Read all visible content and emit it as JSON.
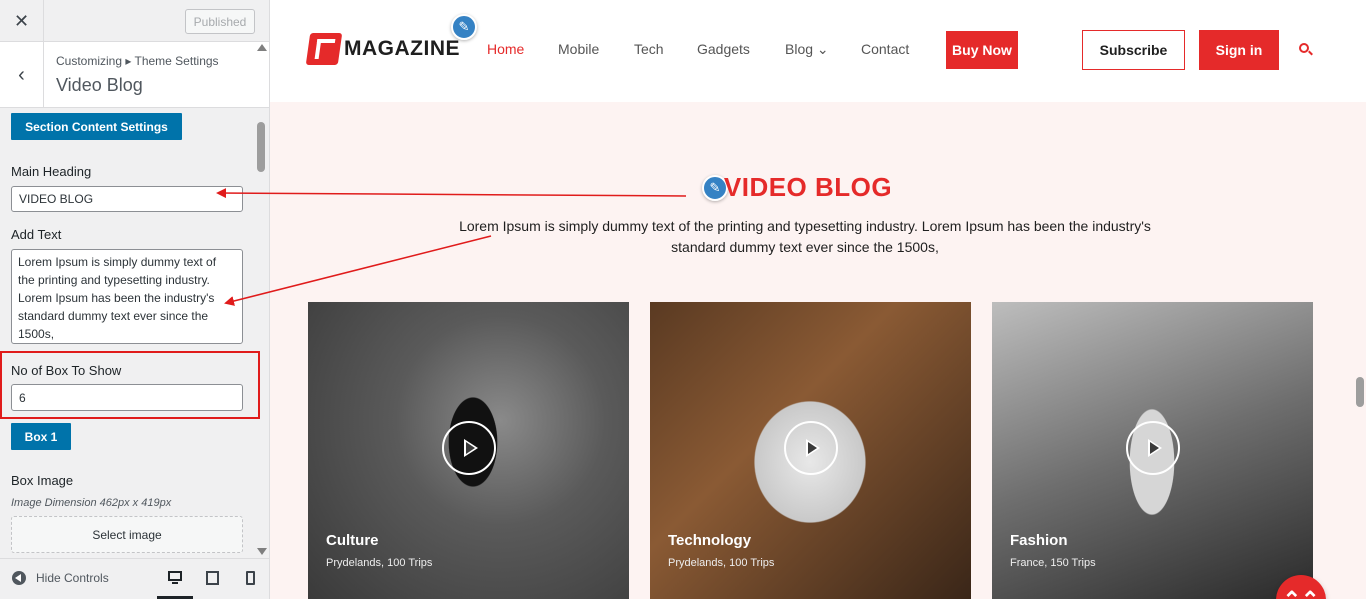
{
  "customizer": {
    "close_label": "✕",
    "published_label": "Published",
    "back_label": "‹",
    "breadcrumb": "Customizing ▸ Theme Settings",
    "title": "Video Blog",
    "section_button": "Section Content Settings",
    "main_heading_label": "Main Heading",
    "main_heading_value": "VIDEO BLOG",
    "add_text_label": "Add Text",
    "add_text_value": "Lorem Ipsum is simply dummy text of the printing and typesetting industry. Lorem Ipsum has been the industry's standard dummy text ever since the 1500s,",
    "boxes_label": "No of Box To Show",
    "boxes_value": "6",
    "box1_button": "Box 1",
    "box_image_label": "Box Image",
    "image_dimension": "Image Dimension 462px x 419px",
    "select_image_label": "Select image",
    "hide_controls_label": "Hide Controls"
  },
  "site": {
    "logo_text": "MAGAZINE",
    "nav": [
      {
        "label": "Home",
        "active": true
      },
      {
        "label": "Mobile",
        "active": false
      },
      {
        "label": "Tech",
        "active": false
      },
      {
        "label": "Gadgets",
        "active": false
      },
      {
        "label": "Blog",
        "active": false
      },
      {
        "label": "Contact",
        "active": false
      }
    ],
    "blog_chevron": "⌄",
    "buy_now": "Buy Now",
    "subscribe": "Subscribe",
    "sign_in": "Sign in",
    "section_heading": "VIDEO BLOG",
    "section_text": "Lorem Ipsum is simply dummy text of the printing and typesetting industry. Lorem Ipsum has been the industry's standard dummy text ever since the 1500s,",
    "cards": [
      {
        "category": "Culture",
        "meta": "Prydelands, 100 Trips"
      },
      {
        "category": "Technology",
        "meta": "Prydelands, 100 Trips"
      },
      {
        "category": "Fashion",
        "meta": "France, 150 Trips"
      }
    ],
    "scroll_top_icon": "⌃⌃",
    "edit_icon": "✎"
  },
  "colors": {
    "accent": "#e52a2a",
    "wp_blue": "#0073aa",
    "section_bg": "#fdf3f2"
  }
}
